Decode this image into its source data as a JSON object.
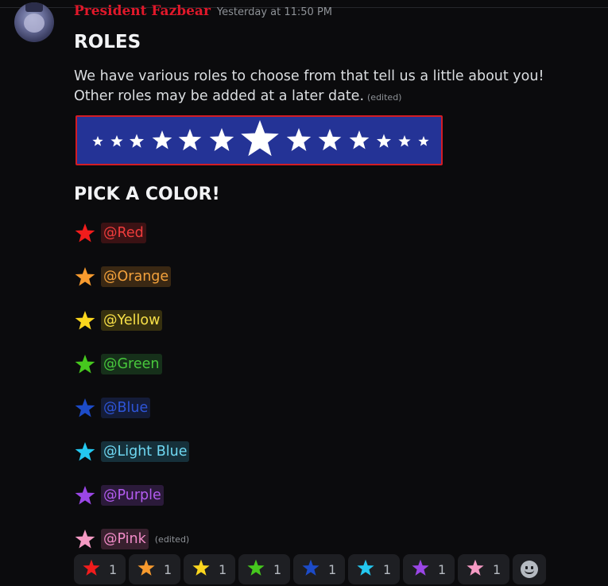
{
  "message": {
    "author": "President Fazbear",
    "timestamp": "Yesterday at 11:50 PM",
    "title": "ROLES",
    "intro_line1": "We have various roles to choose from that tell us a little about you!",
    "intro_line2": "Other roles may be added at a later date.",
    "edited_label": "(edited)",
    "pick_title": "PICK A COLOR!",
    "colors": {
      "author": "#e0182a",
      "banner_bg": "#243396",
      "banner_border": "#d31c24"
    }
  },
  "roles": [
    {
      "mention": "@Red",
      "color": "#f03c3c",
      "bg": "#3b1214",
      "star": "#f21c1c"
    },
    {
      "mention": "@Orange",
      "color": "#f4a23c",
      "bg": "#3a2813",
      "star": "#f79a2e"
    },
    {
      "mention": "@Yellow",
      "color": "#f7e048",
      "bg": "#36300f",
      "star": "#fbd61e"
    },
    {
      "mention": "@Green",
      "color": "#48c83c",
      "bg": "#16301a",
      "star": "#46c81e"
    },
    {
      "mention": "@Blue",
      "color": "#2e55d8",
      "bg": "#141c38",
      "star": "#1c4bc8"
    },
    {
      "mention": "@Light Blue",
      "color": "#6fd8f2",
      "bg": "#16303a",
      "star": "#24c8f0"
    },
    {
      "mention": "@Purple",
      "color": "#b35cf0",
      "bg": "#2b1a3a",
      "star": "#9a46e6"
    },
    {
      "mention": "@Pink",
      "color": "#f28cc8",
      "bg": "#38202e",
      "star": "#f59ac4",
      "edited": "(edited)"
    }
  ],
  "reactions": [
    {
      "star": "#f21c1c",
      "count": "1"
    },
    {
      "star": "#f79a2e",
      "count": "1"
    },
    {
      "star": "#fbd61e",
      "count": "1"
    },
    {
      "star": "#46c81e",
      "count": "1"
    },
    {
      "star": "#1c4bc8",
      "count": "1"
    },
    {
      "star": "#24c8f0",
      "count": "1"
    },
    {
      "star": "#9a46e6",
      "count": "1"
    },
    {
      "star": "#f59ac4",
      "count": "1"
    }
  ],
  "icons": {
    "avatar": "avatar",
    "star": "star-icon",
    "add_reaction": "add-reaction-icon"
  }
}
